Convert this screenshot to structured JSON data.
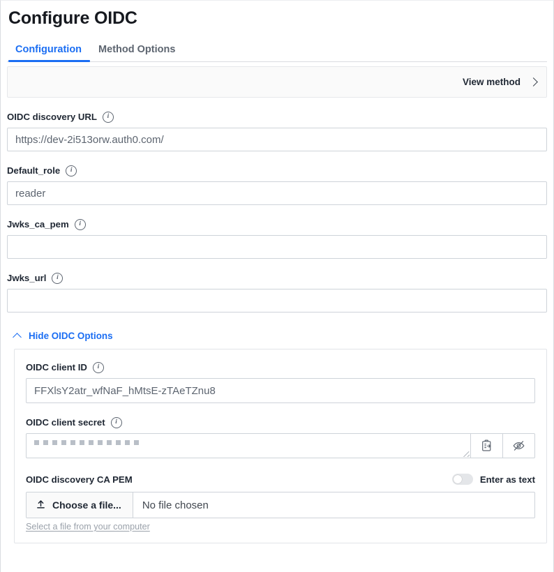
{
  "page": {
    "title": "Configure OIDC"
  },
  "tabs": [
    {
      "label": "Configuration",
      "active": true
    },
    {
      "label": "Method Options",
      "active": false
    }
  ],
  "view_method": {
    "label": "View method",
    "chevron_icon": "chevron-right-icon"
  },
  "fields": {
    "discovery_url": {
      "label": "OIDC discovery URL",
      "info_icon": "info-icon",
      "value": "https://dev-2i513orw.auth0.com/",
      "placeholder": ""
    },
    "default_role": {
      "label": "Default_role",
      "info_icon": "info-icon",
      "value": "reader",
      "placeholder": ""
    },
    "jwks_ca_pem": {
      "label": "Jwks_ca_pem",
      "info_icon": "info-icon",
      "value": "",
      "placeholder": ""
    },
    "jwks_url": {
      "label": "Jwks_url",
      "info_icon": "info-icon",
      "value": "",
      "placeholder": ""
    }
  },
  "collapse": {
    "label": "Hide OIDC Options",
    "chevron_icon": "chevron-up-icon",
    "expanded": true,
    "accent_color": "#1b6ef3"
  },
  "options": {
    "client_id": {
      "label": "OIDC client ID",
      "info_icon": "info-icon",
      "value": "FFXlsY2atr_wfNaF_hMtsE-zTAeTZnu8",
      "placeholder": ""
    },
    "client_secret": {
      "label": "OIDC client secret",
      "info_icon": "info-icon",
      "masked_char_count": 12,
      "copy_icon": "copy-to-clipboard-icon",
      "reveal_icon": "eye-off-icon"
    },
    "ca_pem": {
      "label": "OIDC discovery CA PEM",
      "toggle_label": "Enter as text",
      "toggle_on": false,
      "choose_file_label": "Choose a file...",
      "upload_icon": "upload-icon",
      "file_name": "No file chosen",
      "help_text": "Select a file from your computer"
    }
  }
}
